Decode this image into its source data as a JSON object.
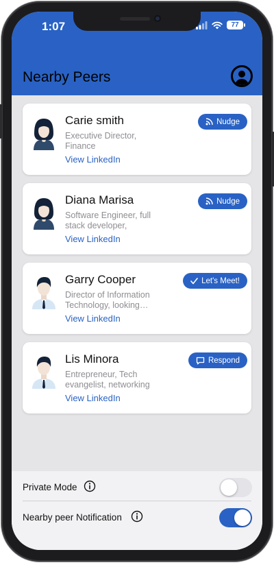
{
  "status_bar": {
    "time": "1:07",
    "battery": "77"
  },
  "header": {
    "title": "Nearby Peers",
    "profile_icon": "account-circle-icon"
  },
  "colors": {
    "accent": "#2962c4",
    "background": "#e5e5e7",
    "toggle_off": "#e4e4e8"
  },
  "peers": [
    {
      "name": "Carie smith",
      "description": "Executive Director, Finance",
      "link": "View LinkedIn",
      "action": "Nudge",
      "action_icon": "rss-icon",
      "avatar": "female-avatar-icon"
    },
    {
      "name": "Diana Marisa",
      "description": "Software Engineer, full stack developer,",
      "link": "View LinkedIn",
      "action": "Nudge",
      "action_icon": "rss-icon",
      "avatar": "female-avatar-icon"
    },
    {
      "name": "Garry Cooper",
      "description": "Director of Information Technology, looking…",
      "link": "View LinkedIn",
      "action": "Let's Meet!",
      "action_icon": "checkmark-icon",
      "avatar": "male-avatar-icon"
    },
    {
      "name": "Lis Minora",
      "description": "Entrepreneur, Tech evangelist, networking",
      "link": "View LinkedIn",
      "action": "Respond",
      "action_icon": "chat-bubble-icon",
      "avatar": "male-avatar-icon"
    }
  ],
  "settings": [
    {
      "label": "Private Mode",
      "enabled": false
    },
    {
      "label": "Nearby peer Notification",
      "enabled": true
    }
  ]
}
